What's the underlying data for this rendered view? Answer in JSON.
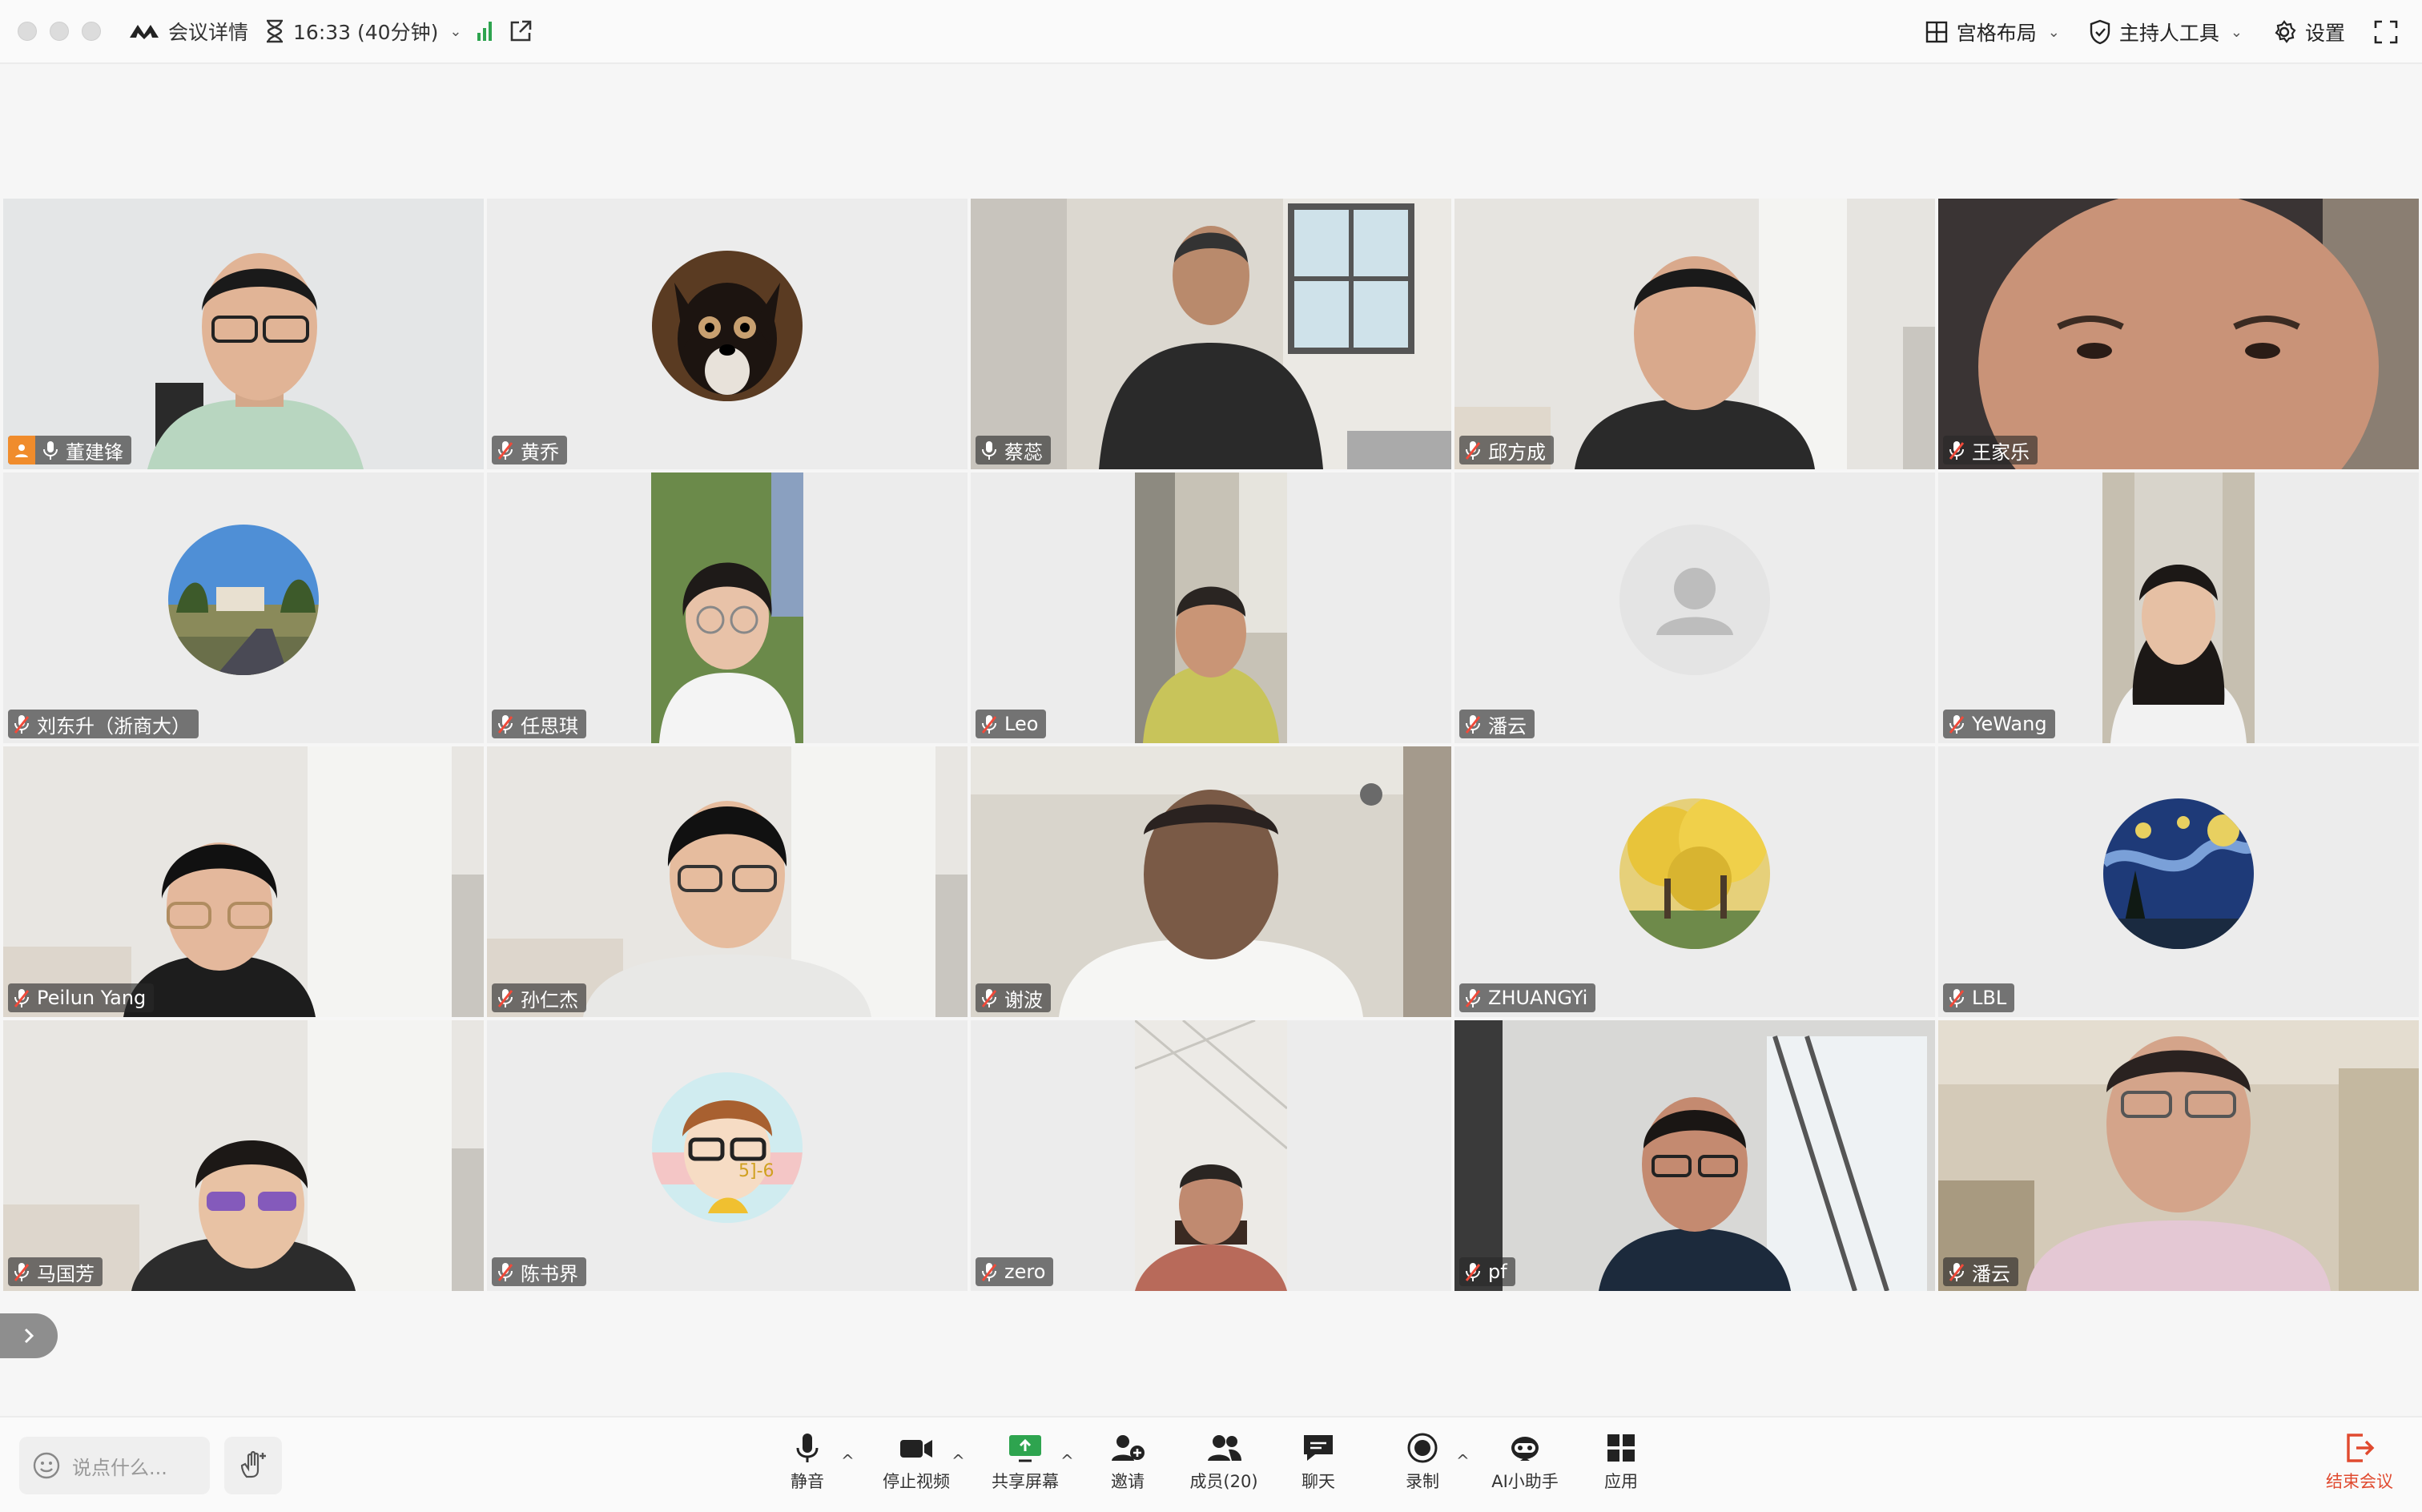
{
  "topbar": {
    "meeting_details": "会议详情",
    "timer": "16:33 (40分钟)",
    "layout": "宫格布局",
    "host_tools": "主持人工具",
    "settings": "设置"
  },
  "participants": [
    {
      "name": "董建锋",
      "type": "video",
      "host": true,
      "muted": false
    },
    {
      "name": "黄乔",
      "type": "avatar",
      "avatar": "dog",
      "muted": true
    },
    {
      "name": "蔡蕊",
      "type": "video",
      "muted": false
    },
    {
      "name": "邱方成",
      "type": "video",
      "muted": true
    },
    {
      "name": "王家乐",
      "type": "video",
      "muted": true
    },
    {
      "name": "刘东升（浙商大）",
      "type": "avatar",
      "avatar": "campus",
      "muted": true
    },
    {
      "name": "任思琪",
      "type": "portrait",
      "muted": true
    },
    {
      "name": "Leo",
      "type": "portrait",
      "muted": true
    },
    {
      "name": "潘云",
      "type": "avatar",
      "avatar": "default",
      "muted": true
    },
    {
      "name": "YeWang",
      "type": "portrait",
      "muted": true
    },
    {
      "name": "Peilun Yang",
      "type": "video",
      "muted": true
    },
    {
      "name": "孙仁杰",
      "type": "video",
      "muted": true
    },
    {
      "name": "谢波",
      "type": "video",
      "muted": true
    },
    {
      "name": "ZHUANGYi",
      "type": "avatar",
      "avatar": "ginkgo",
      "muted": true
    },
    {
      "name": "LBL",
      "type": "avatar",
      "avatar": "starry-night",
      "muted": true
    },
    {
      "name": "马国芳",
      "type": "video",
      "muted": true
    },
    {
      "name": "陈书界",
      "type": "avatar",
      "avatar": "cartoon",
      "muted": true
    },
    {
      "name": "zero",
      "type": "portrait",
      "muted": true
    },
    {
      "name": "pf",
      "type": "video",
      "muted": true
    },
    {
      "name": "潘云",
      "type": "video",
      "muted": true
    }
  ],
  "bottombar": {
    "chat_placeholder": "说点什么...",
    "mute": "静音",
    "stop_video": "停止视频",
    "share_screen": "共享屏幕",
    "invite": "邀请",
    "members": "成员(20)",
    "chat": "聊天",
    "record": "录制",
    "ai_assistant": "AI小助手",
    "apps": "应用",
    "end_meeting": "结束会议"
  },
  "colors": {
    "accent_green": "#2ea44f",
    "end_red": "#e04a2f",
    "host_orange": "#f08c2c"
  }
}
